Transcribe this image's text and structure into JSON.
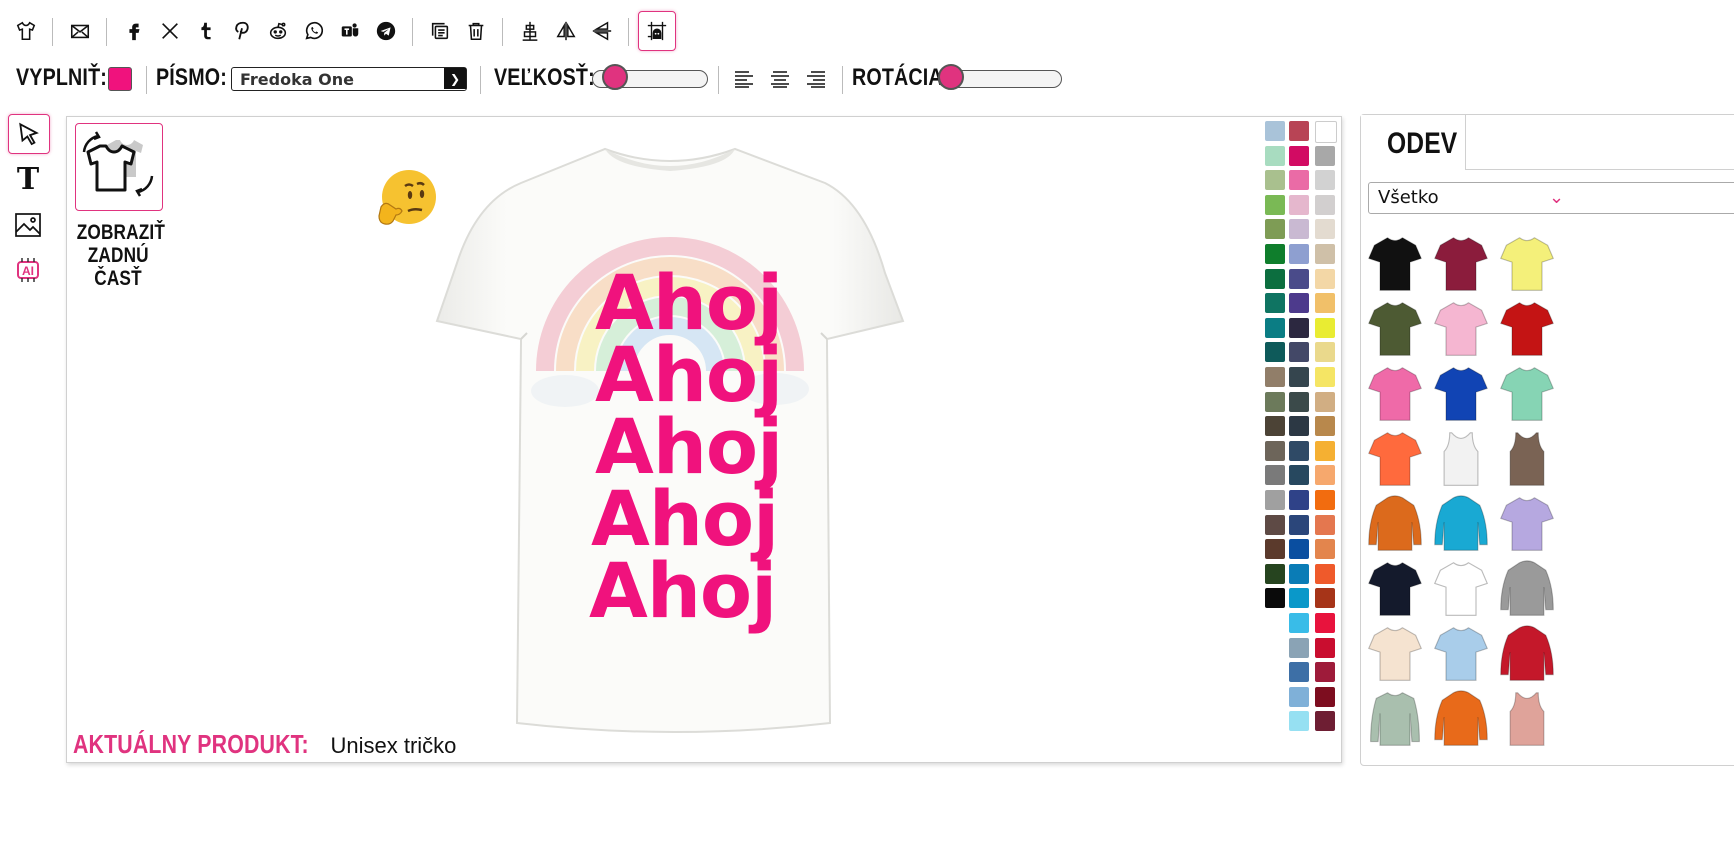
{
  "toolbar": {
    "icons": [
      "tshirt-icon",
      "mail-icon",
      "facebook-icon",
      "x-icon",
      "tumblr-icon",
      "pinterest-icon",
      "reddit-icon",
      "whatsapp-icon",
      "teams-icon",
      "telegram-icon",
      "duplicate-icon",
      "trash-icon",
      "align-center-icon",
      "flip-horizontal-icon",
      "flip-vertical-icon",
      "grid-toggle-icon"
    ]
  },
  "options": {
    "fill_label": "VYPLNIŤ:",
    "fill_color": "#f0127d",
    "font_label": "PÍSMO:",
    "font_value": "Fredoka One",
    "size_label": "VEĽKOSŤ:",
    "size_value": 0.1,
    "rotation_label": "ROTÁCIA:",
    "rotation_value": 0.0
  },
  "tools": [
    "select-tool-icon",
    "text-tool-icon",
    "image-tool-icon",
    "ai-tool-icon"
  ],
  "canvas": {
    "back_label_1": "ZOBRAZIŤ",
    "back_label_2": "ZADNÚ",
    "back_label_3": "ČASŤ",
    "text_lines": [
      "Ahoj",
      "Ahoj",
      "Ahoj",
      "Ahoj",
      "Ahoj"
    ],
    "product_label": "AKTUÁLNY PRODUKT:",
    "product_name": "Unisex tričko",
    "accent": "#e0337f"
  },
  "palette": {
    "col1": [
      "#a9c3d9",
      "#a8dcc0",
      "#a9c08e",
      "#7ab955",
      "#7e9c55",
      "#0f7e2c",
      "#0c6e3f",
      "#0f7462",
      "#0b7d84",
      "#0e5a5a",
      "#917e69",
      "#6c7a5b",
      "#4c4336",
      "#6d655a",
      "#7a7a7a",
      "#a0a0a0",
      "#5e4a45",
      "#5b3a2c",
      "#26441f",
      "#0a0a0a"
    ],
    "col2": [
      "#b84455",
      "#d20b63",
      "#ea6ba6",
      "#e5b7cd",
      "#c9b9d2",
      "#8e9fd0",
      "#4a4b8a",
      "#4d3a8c",
      "#2c2840",
      "#434867",
      "#35454e",
      "#3b4a4a",
      "#2c3844",
      "#2f4a66",
      "#27485f",
      "#2f4288",
      "#2b467a",
      "#0a4ea0",
      "#0a7cb6",
      "#0a98c9",
      "#39bce8",
      "#8aa3b5",
      "#3d6fa6",
      "#7fb0d8",
      "#96e0f2"
    ],
    "col3": [
      "#ffffff",
      "#a8a8a8",
      "#d2d2d2",
      "#d2cfcf",
      "#e3dbd0",
      "#cfc0a8",
      "#f3d7a6",
      "#f1c069",
      "#e9ec32",
      "#ead98c",
      "#f5e564",
      "#d1ae83",
      "#b8884c",
      "#f5b032",
      "#f6a86d",
      "#f26c0f",
      "#e4774f",
      "#e3854d",
      "#ef5a2b",
      "#a63418",
      "#e8133d",
      "#c90d2f",
      "#9e1b3a",
      "#7d0d1f",
      "#6e1e33"
    ]
  },
  "panel": {
    "tab_label": "ODEV",
    "filter_value": "Všetko",
    "items": [
      {
        "name": "black-tshirt",
        "color": "#111111"
      },
      {
        "name": "maroon-tshirt",
        "color": "#8b1c3c"
      },
      {
        "name": "yellow-tshirt",
        "color": "#f4f07a"
      },
      {
        "name": "olive-tshirt",
        "color": "#4d5a33"
      },
      {
        "name": "pink-tshirt",
        "color": "#f5b6d1"
      },
      {
        "name": "red-tshirt",
        "color": "#c41414"
      },
      {
        "name": "pink-women-tshirt",
        "color": "#ef6aa8"
      },
      {
        "name": "blue-tshirt",
        "color": "#1144b4"
      },
      {
        "name": "mint-tshirt",
        "color": "#86d4b4"
      },
      {
        "name": "coral-tshirt",
        "color": "#ff6a3d"
      },
      {
        "name": "white-tank",
        "color": "#f2f2f2"
      },
      {
        "name": "brown-tank",
        "color": "#7a6354"
      },
      {
        "name": "orange-hoodie",
        "color": "#dc6a1c"
      },
      {
        "name": "blue-hoodie",
        "color": "#19a9d3"
      },
      {
        "name": "tiedye-tshirt",
        "color": "#b6a8e0"
      },
      {
        "name": "navy-tshirt",
        "color": "#141a2c"
      },
      {
        "name": "raglan-tshirt",
        "color": "#ffffff"
      },
      {
        "name": "grey-hoodie",
        "color": "#9a9a9a"
      },
      {
        "name": "natural-tshirt",
        "color": "#f5e3d0"
      },
      {
        "name": "dipdye-tshirt",
        "color": "#a9cdea"
      },
      {
        "name": "varsity-jacket",
        "color": "#c4182a"
      },
      {
        "name": "sage-longsleeve",
        "color": "#a9bfae"
      },
      {
        "name": "black-orange-hoodie",
        "color": "#e86a1a"
      },
      {
        "name": "peach-tank",
        "color": "#dfa39a"
      }
    ]
  }
}
